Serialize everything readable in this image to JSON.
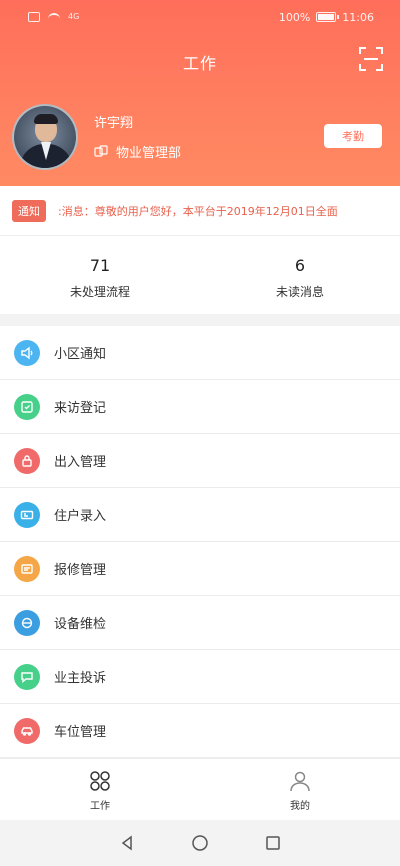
{
  "status_bar": {
    "network": "4G",
    "battery": "100%",
    "time": "11:06"
  },
  "header": {
    "title": "工作",
    "scan_icon": "scan-icon"
  },
  "profile": {
    "name": "许宇翔",
    "department": "物业管理部",
    "attendance_label": "考勤"
  },
  "notice": {
    "tag": "通知",
    "text": ":消息：尊敬的用户您好，本平台于2019年12月01日全面"
  },
  "stats": [
    {
      "value": "71",
      "label": "未处理流程"
    },
    {
      "value": "6",
      "label": "未读消息"
    }
  ],
  "menu": [
    {
      "label": "小区通知",
      "icon": "speaker-icon",
      "color": "#4cb4f0"
    },
    {
      "label": "来访登记",
      "icon": "register-icon",
      "color": "#46d08a"
    },
    {
      "label": "出入管理",
      "icon": "lock-icon",
      "color": "#f06a6a"
    },
    {
      "label": "住户录入",
      "icon": "id-card-icon",
      "color": "#3ab0e8"
    },
    {
      "label": "报修管理",
      "icon": "repair-icon",
      "color": "#f5a646"
    },
    {
      "label": "设备维检",
      "icon": "device-icon",
      "color": "#3a9ee0"
    },
    {
      "label": "业主投诉",
      "icon": "complaint-icon",
      "color": "#46d08a"
    },
    {
      "label": "车位管理",
      "icon": "car-icon",
      "color": "#f06a6a"
    }
  ],
  "bottom_nav": [
    {
      "label": "工作",
      "icon": "grid-icon"
    },
    {
      "label": "我的",
      "icon": "person-icon"
    }
  ],
  "colors": {
    "header_gradient_top": "#ff6e5a",
    "header_gradient_bottom": "#ff8a62",
    "notice_tag": "#ef6b5a",
    "notice_text": "#e8604c"
  }
}
